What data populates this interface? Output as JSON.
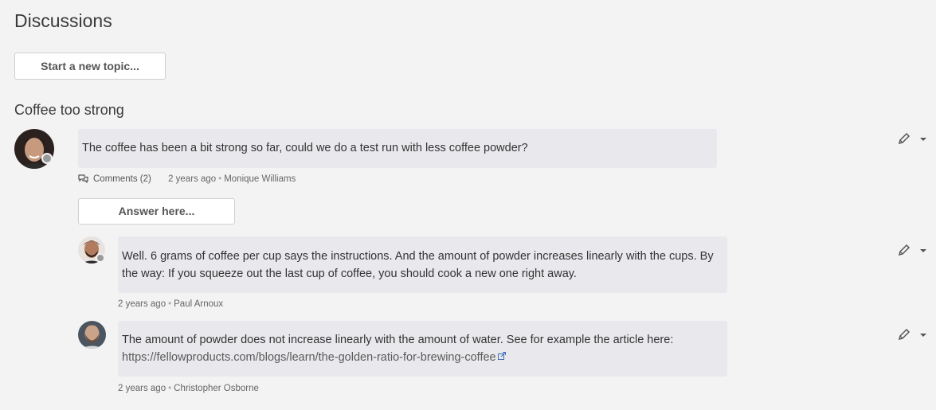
{
  "page": {
    "title": "Discussions"
  },
  "toolbar": {
    "new_topic_label": "Start a new topic..."
  },
  "topic": {
    "title": "Coffee too strong",
    "post": {
      "text": "The coffee has been a bit strong so far, could we do a test run with less coffee powder?",
      "comments_label": "Comments (2)",
      "time": "2 years ago",
      "author": "Monique Williams"
    },
    "answer_label": "Answer here...",
    "replies": [
      {
        "text_line1": "Well. 6 grams of coffee per cup says the instructions. And the amount of powder increases linearly with the cups. By",
        "text_line2": "the way: If you squeeze out the last cup of coffee, you should cook a new one right away.",
        "time": "2 years ago",
        "author": "Paul Arnoux"
      },
      {
        "text_line1": "The amount of powder does not increase linearly with the amount of water. See for example the article here:",
        "link": "https://fellowproducts.com/blogs/learn/the-golden-ratio-for-brewing-coffee",
        "time": "2 years ago",
        "author": "Christopher Osborne"
      }
    ]
  },
  "icons": {
    "edit": "pencil-icon",
    "menu": "caret-down-icon",
    "comments": "speech-bubbles-icon",
    "external": "external-link-icon"
  },
  "colors": {
    "background": "#f3f3f3",
    "bubble": "#e9e8ec",
    "status_dot": "#9a9a9a"
  }
}
